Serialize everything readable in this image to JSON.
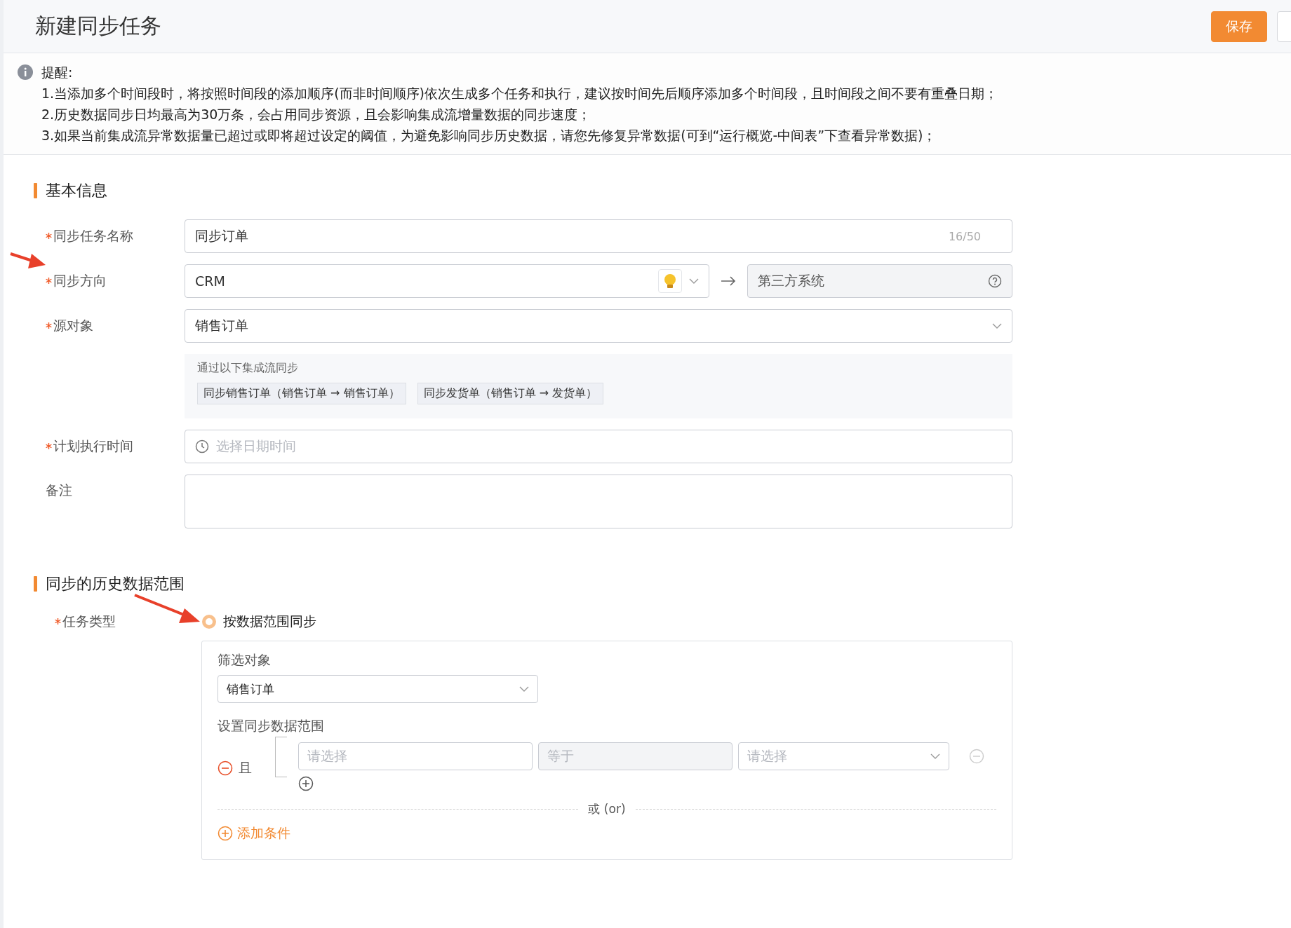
{
  "header": {
    "title": "新建同步任务",
    "buttons": [
      {
        "label": "保存",
        "kind": "primary"
      },
      {
        "kind": "cut"
      }
    ]
  },
  "notice": {
    "title": "提醒:",
    "lines": [
      "1.当添加多个时间段时，将按照时间段的添加顺序(而非时间顺序)依次生成多个任务和执行，建议按时间先后顺序添加多个时间段，且时间段之间不要有重叠日期；",
      "2.历史数据同步日均最高为30万条，会占用同步资源，且会影响集成流增量数据的同步速度；",
      "3.如果当前集成流异常数据量已超过或即将超过设定的阈值，为避免影响同步历史数据，请您先修复异常数据(可到“运行概览-中间表”下查看异常数据)；"
    ]
  },
  "basic_info": {
    "title": "基本信息",
    "task_name": {
      "label": "同步任务名称",
      "required": true,
      "value": "同步订单",
      "counter": "16/50"
    },
    "direction": {
      "label": "同步方向",
      "required": true,
      "source": "CRM",
      "target": "第三方系统"
    },
    "source_object": {
      "label": "源对象",
      "required": true,
      "value": "销售订单"
    },
    "flows": {
      "caption": "通过以下集成流同步",
      "tags": [
        "同步销售订单（销售订单 → 销售订单）",
        "同步发货单（销售订单 → 发货单）"
      ]
    },
    "schedule": {
      "label": "计划执行时间",
      "required": true,
      "placeholder": "选择日期时间"
    },
    "remarks": {
      "label": "备注",
      "required": false
    }
  },
  "history_range": {
    "title": "同步的历史数据范围",
    "task_type": {
      "label": "任务类型",
      "required": true,
      "option": "按数据范围同步",
      "selected": true
    },
    "filter_object": {
      "label": "筛选对象",
      "value": "销售订单"
    },
    "range": {
      "label": "设置同步数据范围",
      "group_operator": "且",
      "field_placeholder": "请选择",
      "operator": "等于",
      "value_placeholder": "请选择",
      "or_label": "或 (or)",
      "add_condition": "添加条件"
    }
  }
}
